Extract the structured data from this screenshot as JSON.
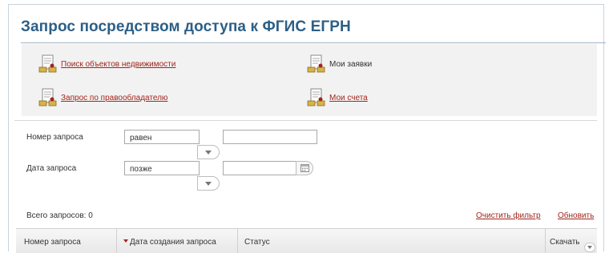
{
  "page": {
    "title": "Запрос посредством доступа к ФГИС ЕГРН"
  },
  "menu": {
    "search_objects": "Поиск объектов недвижимости",
    "my_requests": "Мои заявки",
    "owner_request": "Запрос по правообладателю",
    "my_accounts": "Мои счета"
  },
  "filter": {
    "request_number": {
      "label": "Номер запроса",
      "condition": "равен",
      "value": ""
    },
    "request_date": {
      "label": "Дата запроса",
      "condition": "позже",
      "value": ""
    }
  },
  "results": {
    "total_label": "Всего запросов: 0",
    "clear_filter": "Очистить фильтр",
    "refresh": "Обновить"
  },
  "table": {
    "columns": [
      {
        "label": "Номер запроса",
        "sorted": false
      },
      {
        "label": "Дата создания запроса",
        "sorted": true,
        "sort_direction": "desc"
      },
      {
        "label": "Статус",
        "sorted": false
      },
      {
        "label": "Скачать",
        "sorted": false
      }
    ]
  },
  "icons": {
    "menu_item": "document-stamp-icon",
    "dropdown": "chevron-down-icon",
    "calendar": "calendar-icon",
    "sort": "sort-desc-icon"
  },
  "colors": {
    "title": "#2c5f86",
    "link": "#a1251c",
    "panel_bg": "#f2f2f2"
  }
}
